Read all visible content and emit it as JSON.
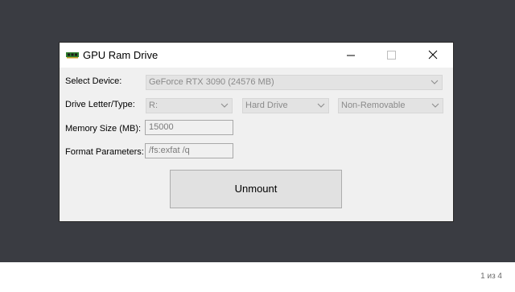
{
  "window": {
    "title": "GPU Ram Drive",
    "icon": "ram-module-icon"
  },
  "form": {
    "device_label": "Select Device:",
    "device_value": "GeForce RTX 3090 (24576 MB)",
    "drive_label": "Drive Letter/Type:",
    "drive_letter": "R:",
    "drive_type": "Hard Drive",
    "drive_removable": "Non-Removable",
    "memory_label": "Memory Size (MB):",
    "memory_value": "15000",
    "format_label": "Format Parameters:",
    "format_value": "/fs:exfat /q"
  },
  "actions": {
    "unmount_label": "Unmount"
  },
  "viewer": {
    "page_counter": "1 из 4"
  },
  "colors": {
    "backdrop": "#3a3c42",
    "window_bg": "#f0f0f0",
    "titlebar_bg": "#ffffff",
    "disabled_combo_bg": "#e3e3e3",
    "button_bg": "#e1e1e1"
  }
}
